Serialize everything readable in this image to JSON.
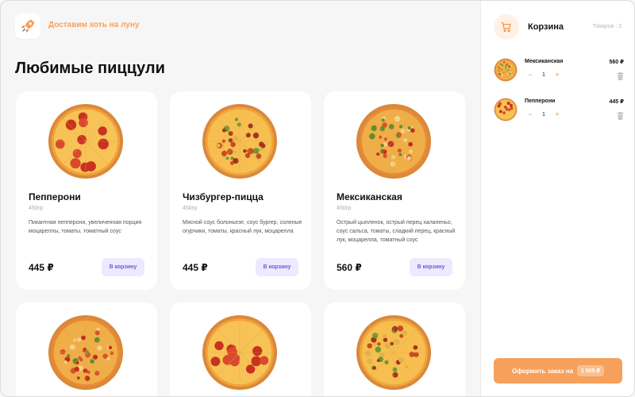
{
  "brand": {
    "tagline": "Доставим хоть на луну"
  },
  "page_title": "Любимые пиццули",
  "products": [
    {
      "name": "Пепперони",
      "weight": "450гр",
      "description": "Пикантная пепперони, увеличенная порция моцареллы, томаты, томатный соус",
      "price": "445 ₽",
      "button": "В корзину",
      "style": "pepperoni"
    },
    {
      "name": "Чизбургер-пицца",
      "weight": "450гр",
      "description": "Мясной соус болоньезе, соус бургер, соленые огурчики, томаты, красный лук, моцарелла",
      "price": "445 ₽",
      "button": "В корзину",
      "style": "cheeseburger"
    },
    {
      "name": "Мексиканская",
      "weight": "450гр",
      "description": "Острый цыпленок, острый перец халапеньо, соус сальса, томаты, сладкий перец, красный лук, моцарелла, томатный соус",
      "price": "560 ₽",
      "button": "В корзину",
      "style": "mexican"
    },
    {
      "style": "mexican"
    },
    {
      "style": "pepperoni"
    },
    {
      "style": "cheeseburger"
    }
  ],
  "cart": {
    "title": "Корзина",
    "count_label": "Товаров : 2",
    "items": [
      {
        "name": "Мексиканская",
        "price": "560 ₽",
        "qty": "1",
        "minus": "−",
        "plus": "+",
        "style": "mexican"
      },
      {
        "name": "Пепперони",
        "price": "445 ₽",
        "qty": "1",
        "minus": "−",
        "plus": "+",
        "style": "pepperoni"
      }
    ],
    "checkout_label": "Оформить заказ на",
    "checkout_total": "1 005 ₽"
  },
  "icons": {
    "logo": "rocket-icon",
    "cart": "cart-icon",
    "trash": "trash-icon"
  },
  "colors": {
    "accent": "#f6a05c",
    "button_bg": "#eceaff",
    "button_text": "#6f5bd8"
  }
}
